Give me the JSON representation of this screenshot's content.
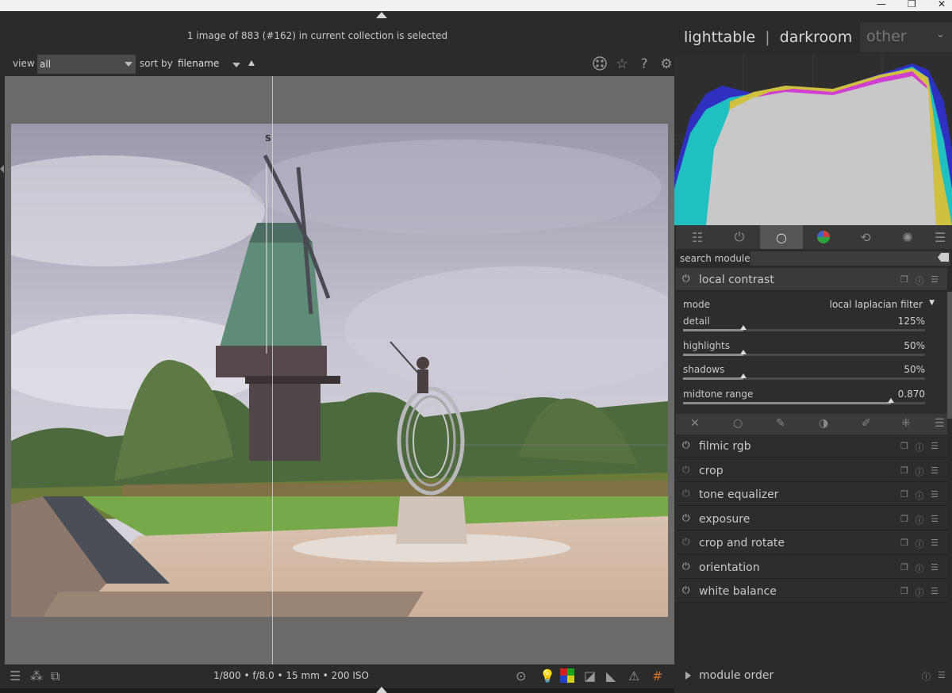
{
  "window": {
    "minimize": "—",
    "restore": "❐",
    "close": "✕"
  },
  "status": "1 image of 883 (#162) in current collection is selected",
  "views": {
    "lighttable": "lighttable",
    "darkroom": "darkroom",
    "other": "other",
    "sep": "|"
  },
  "filter": {
    "view_label": "view",
    "view_value": "all",
    "sort_label": "sort by",
    "sort_value": "filename"
  },
  "exif": "1/800 • f/8.0 • 15 mm • 200 ISO",
  "search": {
    "label": "search module",
    "value": ""
  },
  "local_contrast": {
    "name": "local contrast",
    "mode_label": "mode",
    "mode_value": "local laplacian filter",
    "params": [
      {
        "label": "detail",
        "value": "125%",
        "fraction": 0.25
      },
      {
        "label": "highlights",
        "value": "50%",
        "fraction": 0.25
      },
      {
        "label": "shadows",
        "value": "50%",
        "fraction": 0.25
      },
      {
        "label": "midtone range",
        "value": "0.870",
        "fraction": 0.86
      }
    ]
  },
  "modules": [
    {
      "name": "filmic rgb",
      "enabled": true
    },
    {
      "name": "crop",
      "enabled": false
    },
    {
      "name": "tone equalizer",
      "enabled": false
    },
    {
      "name": "exposure",
      "enabled": true
    },
    {
      "name": "crop and rotate",
      "enabled": false
    },
    {
      "name": "orientation",
      "enabled": true
    },
    {
      "name": "white balance",
      "enabled": true
    }
  ],
  "footer": {
    "module_order": "module order"
  },
  "photo_letter": "S"
}
